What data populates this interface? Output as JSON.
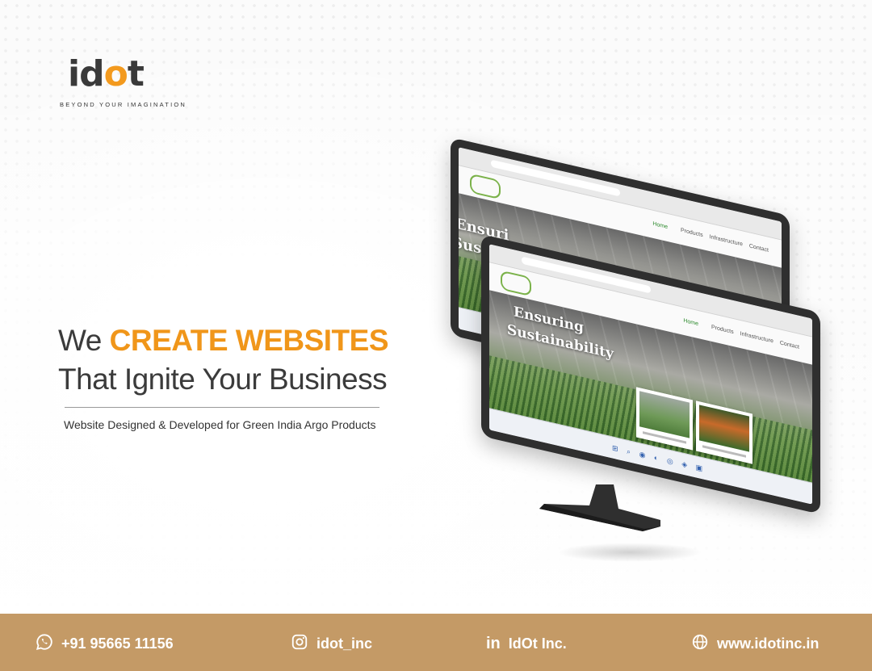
{
  "brand": {
    "logo_text_pre": "id",
    "logo_text_o": "o",
    "logo_text_post": "t",
    "tagline": "BEYOND YOUR IMAGINATION",
    "accent_color": "#f0961a",
    "footer_color": "#c49a66"
  },
  "headline": {
    "line1_prefix": "We",
    "line1_accent": "CREATE WEBSITES",
    "line2": "That Ignite Your Business",
    "subline": "Website Designed & Developed for Green India Argo Products"
  },
  "mockup": {
    "back_hero_text_1": "Ensuri",
    "back_hero_text_2": "Sustain",
    "front_hero_text_1": "Ensuring",
    "front_hero_text_2": "Sustainability",
    "nav_items": [
      "Home",
      "Products",
      "Infrastructure",
      "Contact"
    ]
  },
  "footer": {
    "phone": "+91 95665 11156",
    "instagram": "idot_inc",
    "linkedin": "IdOt Inc.",
    "website": "www.idotinc.in",
    "icons": [
      "whatsapp-icon",
      "instagram-icon",
      "linkedin-icon",
      "globe-icon"
    ]
  }
}
